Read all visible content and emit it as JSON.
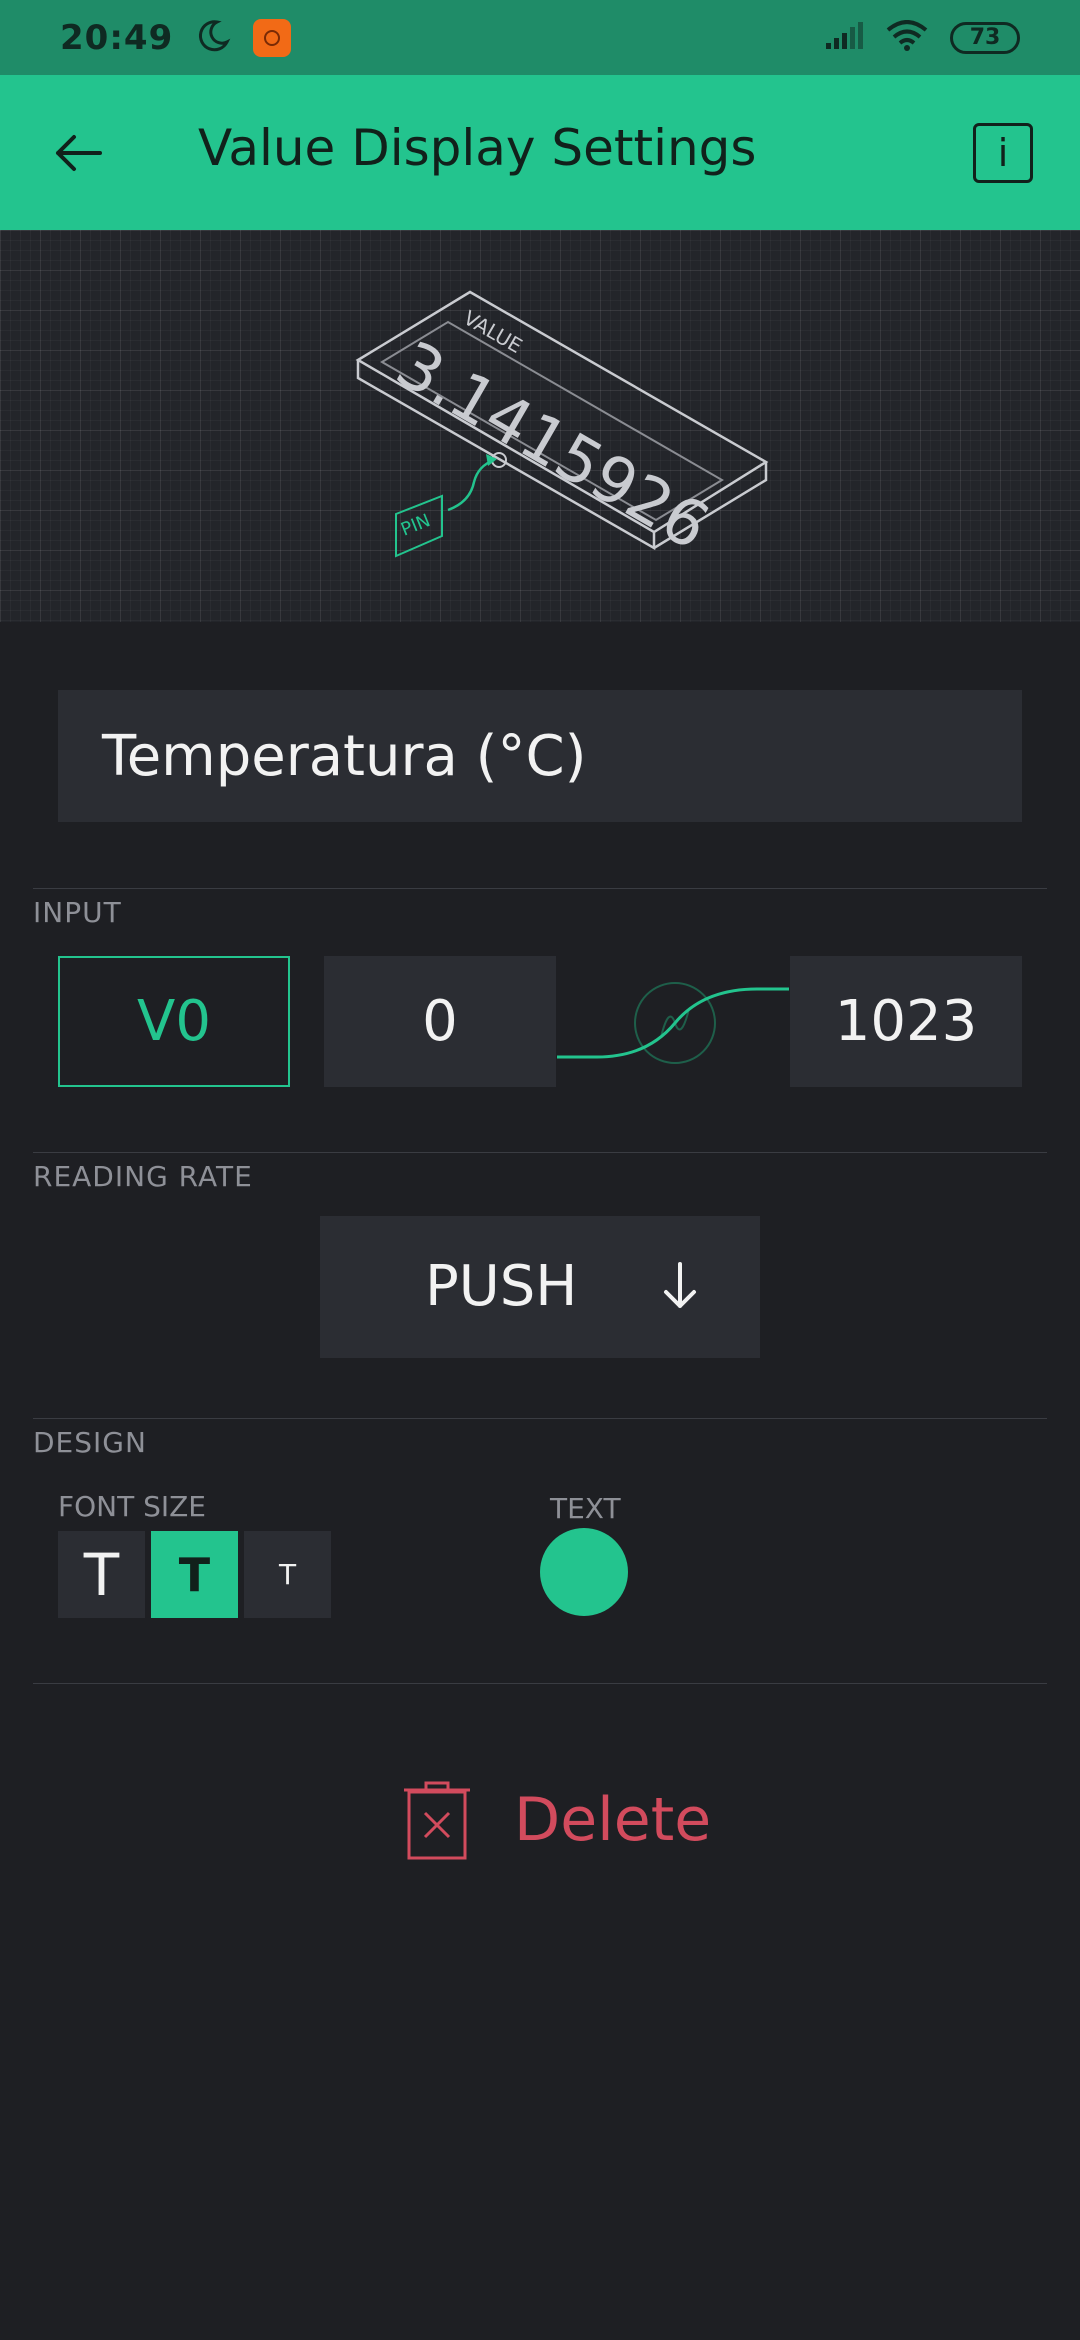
{
  "status_bar": {
    "time": "20:49",
    "battery": "73"
  },
  "app_bar": {
    "title": "Value Display Settings",
    "info_label": "i"
  },
  "hero": {
    "device_label": "VALUE",
    "device_value": "3.1415926",
    "pin_label": "PIN"
  },
  "widget": {
    "name_value": "Temperatura (°C)"
  },
  "input": {
    "section_label": "INPUT",
    "pin": "V0",
    "min": "0",
    "max": "1023"
  },
  "reading_rate": {
    "section_label": "READING RATE",
    "value": "PUSH"
  },
  "design": {
    "section_label": "DESIGN",
    "font_size_label": "FONT SIZE",
    "font_size_options": [
      "T",
      "T",
      "T"
    ],
    "font_size_selected_index": 1,
    "text_color_label": "TEXT",
    "text_color": "#23c48e"
  },
  "delete": {
    "label": "Delete"
  },
  "colors": {
    "accent": "#23c48e",
    "danger": "#d24b5d",
    "background": "#1e1f23"
  }
}
